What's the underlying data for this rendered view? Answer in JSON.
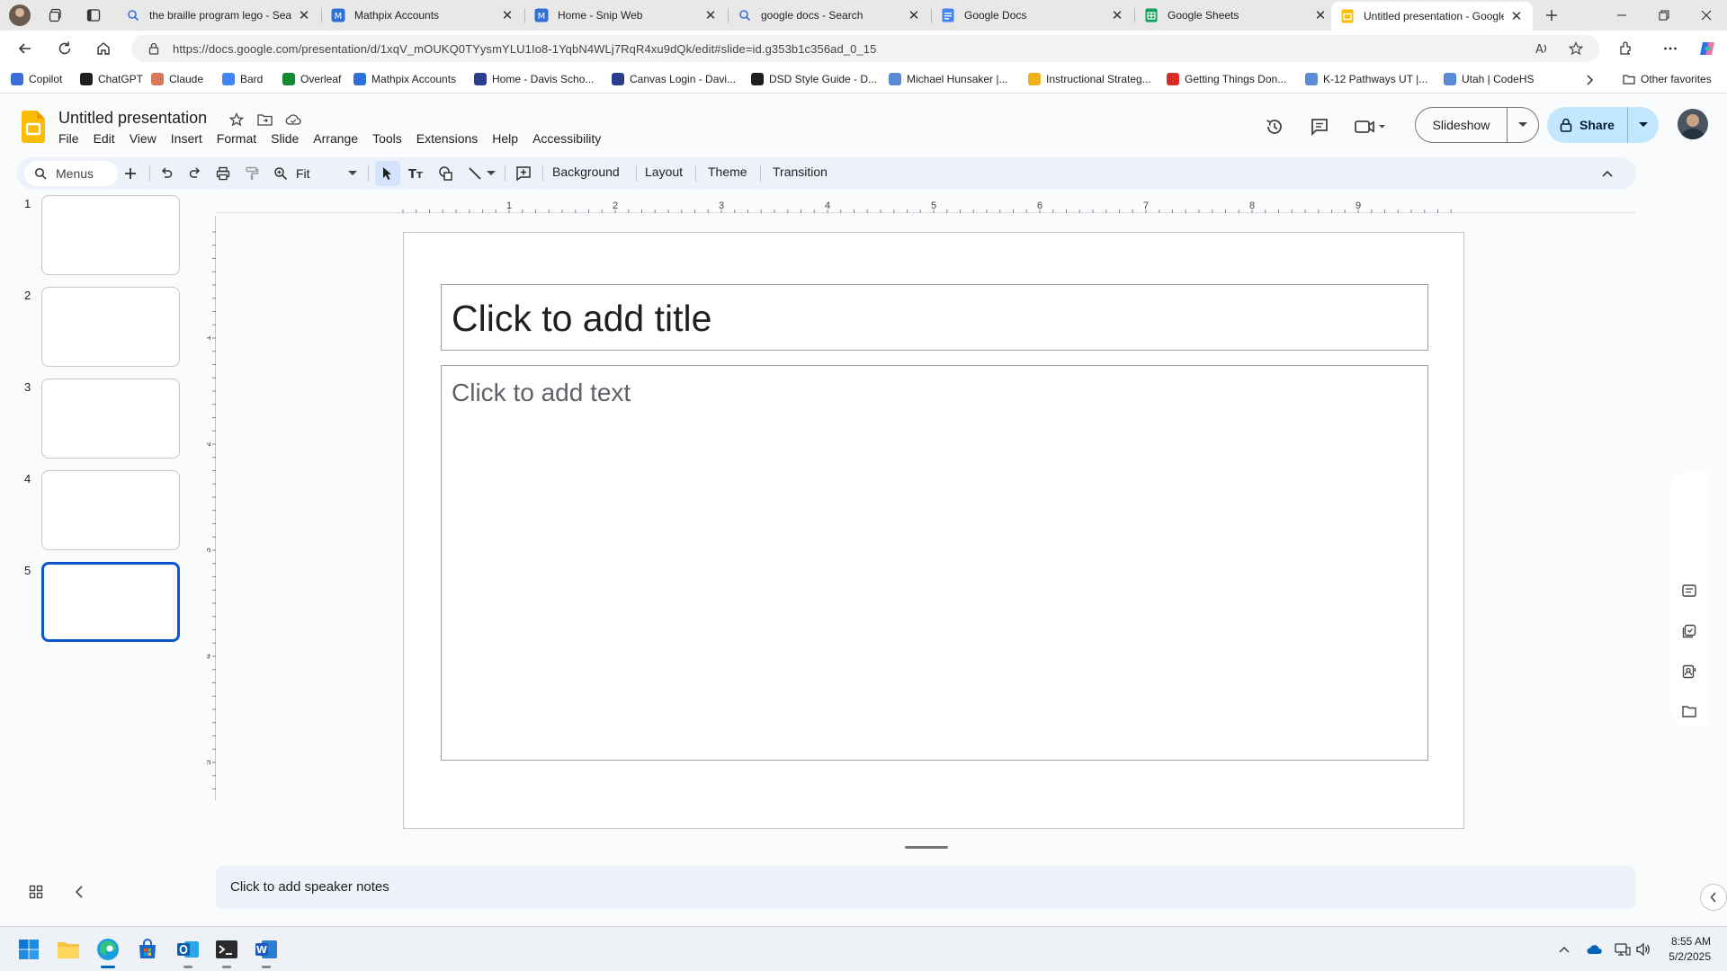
{
  "browser": {
    "tabs": [
      {
        "title": "the braille program lego - Search",
        "icon": "search-icon"
      },
      {
        "title": "Mathpix Accounts",
        "icon": "mathpix-icon"
      },
      {
        "title": "Home - Snip Web",
        "icon": "mathpix-icon"
      },
      {
        "title": "google docs - Search",
        "icon": "search-icon"
      },
      {
        "title": "Google Docs",
        "icon": "docs-icon"
      },
      {
        "title": "Google Sheets",
        "icon": "sheets-icon"
      },
      {
        "title": "Untitled presentation - Google Slides",
        "icon": "slides-icon"
      }
    ],
    "url": "https://docs.google.com/presentation/d/1xqV_mOUKQ0TYysmYLU1Io8-1YqbN4WLj7RqR4xu9dQk/edit#slide=id.g353b1c356ad_0_15",
    "favorites": [
      {
        "label": "Copilot",
        "color": "#3b6fd8"
      },
      {
        "label": "ChatGPT",
        "color": "#1f1f1f"
      },
      {
        "label": "Claude",
        "color": "#d97757"
      },
      {
        "label": "Bard",
        "color": "#4285f4"
      },
      {
        "label": "Overleaf",
        "color": "#138a36"
      },
      {
        "label": "Mathpix Accounts",
        "color": "#2e6fd8"
      },
      {
        "label": "Home - Davis Scho...",
        "color": "#2b3f8c"
      },
      {
        "label": "Canvas Login - Davi...",
        "color": "#2b3f8c"
      },
      {
        "label": "DSD Style Guide - D...",
        "color": "#1f1f1f"
      },
      {
        "label": "Michael Hunsaker |...",
        "color": "#5b8bd6"
      },
      {
        "label": "Instructional Strateg...",
        "color": "#f2b01e"
      },
      {
        "label": "Getting Things Don...",
        "color": "#d93025"
      },
      {
        "label": "K-12 Pathways UT |...",
        "color": "#5b8bd6"
      },
      {
        "label": "Utah | CodeHS",
        "color": "#5b8bd6"
      }
    ],
    "other_favorites": "Other favorites"
  },
  "app": {
    "doc_title": "Untitled presentation",
    "menu": [
      "File",
      "Edit",
      "View",
      "Insert",
      "Format",
      "Slide",
      "Arrange",
      "Tools",
      "Extensions",
      "Help",
      "Accessibility"
    ],
    "slideshow_label": "Slideshow",
    "share_label": "Share"
  },
  "toolbar": {
    "search_label": "Menus",
    "zoom": "Fit",
    "background_label": "Background",
    "layout_label": "Layout",
    "theme_label": "Theme",
    "transition_label": "Transition"
  },
  "filmstrip": {
    "slides": [
      "1",
      "2",
      "3",
      "4",
      "5"
    ],
    "selected_index": 5
  },
  "ruler": {
    "horizontal": [
      "1",
      "2",
      "3",
      "4",
      "5",
      "6",
      "7",
      "8",
      "9"
    ],
    "vertical": [
      "1",
      "2",
      "3",
      "4",
      "5"
    ]
  },
  "slide": {
    "title_placeholder": "Click to add title",
    "body_placeholder": "Click to add text"
  },
  "notes": {
    "placeholder": "Click to add speaker notes"
  },
  "taskbar": {
    "time": "8:55 AM",
    "date": "5/2/2025"
  },
  "colors": {
    "accent": "#0b57d0",
    "share_bg": "#c2e7ff",
    "toolbar_bg": "#edf2fa",
    "slides_yellow": "#fbbc04"
  }
}
